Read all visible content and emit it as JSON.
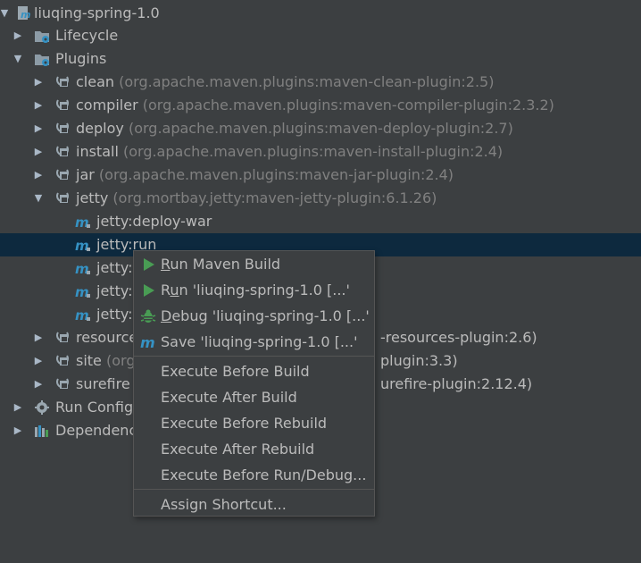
{
  "tree": {
    "root": {
      "label": "liuqing-spring-1.0"
    },
    "lifecycle": {
      "label": "Lifecycle"
    },
    "plugins": {
      "label": "Plugins"
    },
    "clean": {
      "name": "clean",
      "coord": "(org.apache.maven.plugins:maven-clean-plugin:2.5)"
    },
    "compiler": {
      "name": "compiler",
      "coord": "(org.apache.maven.plugins:maven-compiler-plugin:2.3.2)"
    },
    "deploy": {
      "name": "deploy",
      "coord": "(org.apache.maven.plugins:maven-deploy-plugin:2.7)"
    },
    "install": {
      "name": "install",
      "coord": "(org.apache.maven.plugins:maven-install-plugin:2.4)"
    },
    "jar": {
      "name": "jar",
      "coord": "(org.apache.maven.plugins:maven-jar-plugin:2.4)"
    },
    "jetty": {
      "name": "jetty",
      "coord": "(org.mortbay.jetty:maven-jetty-plugin:6.1.26)"
    },
    "goals": [
      "jetty:deploy-war",
      "jetty:run",
      "jetty:r",
      "jetty:r",
      "jetty:s"
    ],
    "resources": {
      "name": "resource",
      "coord_tail": "-resources-plugin:2.6)"
    },
    "site": {
      "name": "site",
      "coord_head": "(org.",
      "coord_tail": "plugin:3.3)"
    },
    "surefire": {
      "name": "surefire",
      "coord_head": "(",
      "coord_tail": "urefire-plugin:2.12.4)"
    },
    "run_configs": {
      "label": "Run Config"
    },
    "dependencies": {
      "label": "Dependenc"
    }
  },
  "context_menu": {
    "run_maven_build": {
      "first": "R",
      "rest": "un Maven Build"
    },
    "run_config": {
      "pre": "R",
      "u": "u",
      "post": "n 'liuqing-spring-1.0 [...'"
    },
    "debug_config": {
      "first": "D",
      "rest": "ebug 'liuqing-spring-1.0 [...'"
    },
    "save_config": "Save 'liuqing-spring-1.0 [...'",
    "execute_before_build": "Execute Before Build",
    "execute_after_build": "Execute After Build",
    "execute_before_rebuild": "Execute Before Rebuild",
    "execute_after_rebuild": "Execute After Rebuild",
    "execute_before_run_debug": "Execute Before Run/Debug...",
    "assign_shortcut": "Assign Shortcut..."
  },
  "colors": {
    "background": "#3c3f41",
    "selection": "#0d293e",
    "text": "#bbbbbb",
    "muted_text": "#808080",
    "run_green": "#499c54",
    "maven_blue": "#3592c4"
  }
}
